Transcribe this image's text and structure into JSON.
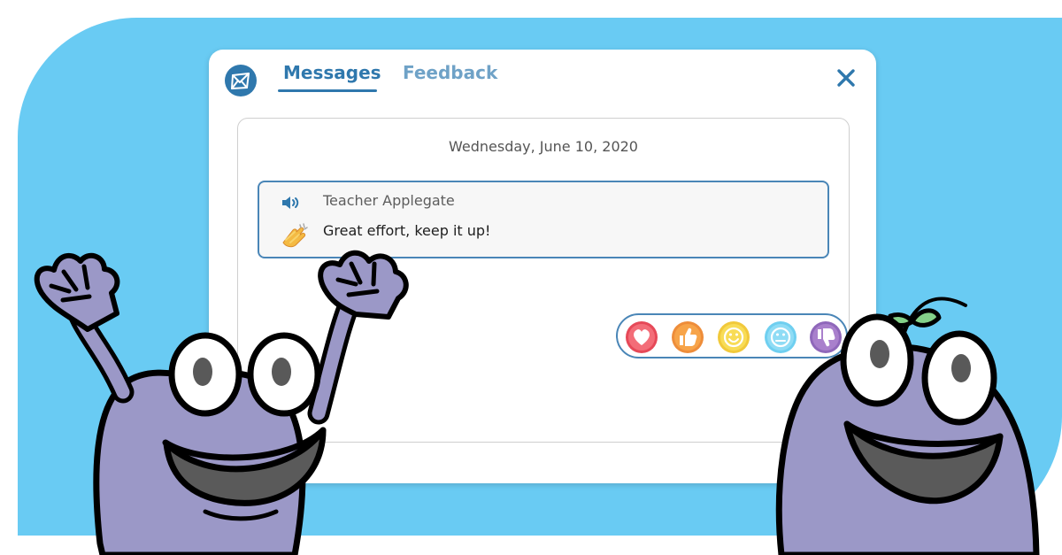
{
  "window": {
    "tabs": [
      {
        "label": "Messages",
        "active": true
      },
      {
        "label": "Feedback",
        "active": false
      }
    ]
  },
  "message_thread": {
    "date": "Wednesday, June 10, 2020",
    "messages": [
      {
        "sender": "Teacher Applegate",
        "text": "Great effort, keep it up!",
        "sender_icon": "speaker-icon",
        "message_icon": "clapping-hands-icon"
      }
    ]
  },
  "reactions": [
    {
      "icon": "heart-icon",
      "color": "#e64958"
    },
    {
      "icon": "thumbs-up-icon",
      "color": "#ee8d3a"
    },
    {
      "icon": "smiley-icon",
      "color": "#f1c93b"
    },
    {
      "icon": "neutral-face-icon",
      "color": "#6fcff0"
    },
    {
      "icon": "thumbs-down-icon",
      "color": "#8f67ba"
    }
  ],
  "colors": {
    "background": "#69cbf3",
    "window": "#ffffff",
    "accent": "#2f78ad",
    "inactive_tab": "#6fa2c7",
    "message_border": "#4a86b7",
    "character": "#9b98c7"
  }
}
